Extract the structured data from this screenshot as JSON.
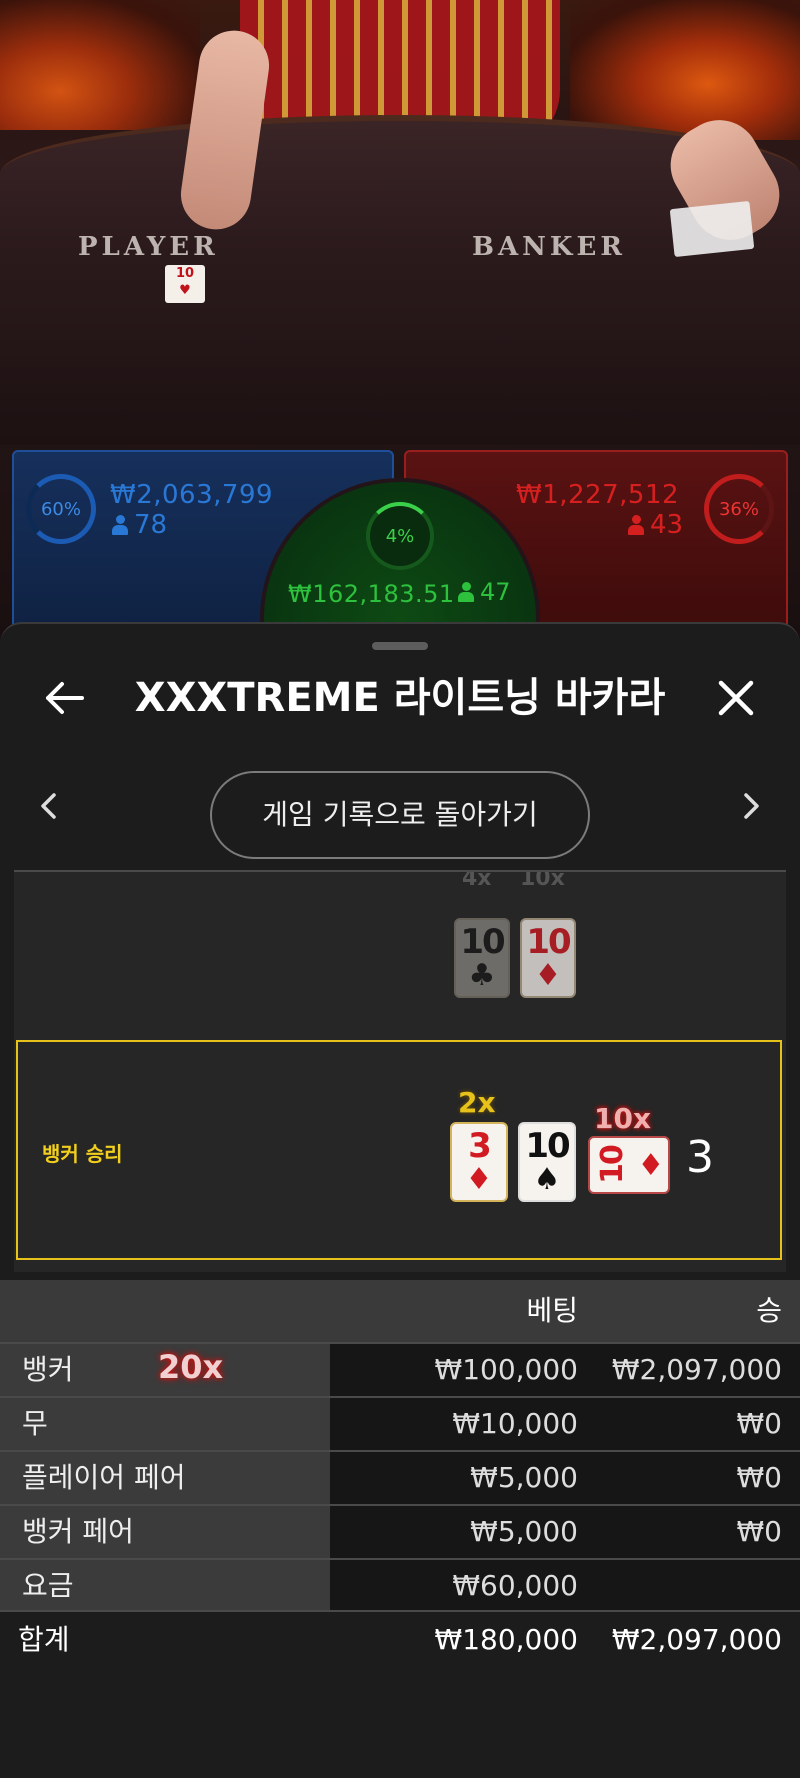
{
  "video": {
    "felt_player": "PLAYER",
    "felt_banker": "BANKER",
    "felt_card": "10",
    "player": {
      "percent": "60%",
      "amount": "₩2,063,799",
      "players": "78",
      "color": "#2a78d6"
    },
    "banker": {
      "percent": "36%",
      "amount": "₩1,227,512",
      "players": "43",
      "color": "#d62020"
    },
    "tie": {
      "percent": "4%",
      "amount": "₩162,183.51",
      "players": "47",
      "color": "#2ec13e"
    }
  },
  "sheet": {
    "title": "XXXTREME 라이트닝 바카라",
    "back_button": "게임 기록으로 돌아가기",
    "history": {
      "partial_row": {
        "multipliers": [
          "4x",
          "10x"
        ],
        "cards": [
          {
            "rank": "10",
            "suit": "♣"
          },
          {
            "rank": "10",
            "suit": "♦"
          }
        ]
      },
      "selected_row": {
        "label": "뱅커 승리",
        "multipliers": [
          "2x",
          "10x"
        ],
        "cards": [
          {
            "rank": "3",
            "suit": "♦"
          },
          {
            "rank": "10",
            "suit": "♠"
          },
          {
            "rank": "10",
            "suit": "♦"
          }
        ],
        "score": "3"
      }
    },
    "table": {
      "headers": {
        "bet": "베팅",
        "win": "승"
      },
      "rows": [
        {
          "label": "뱅커",
          "multiplier": "20x",
          "bet": "₩100,000",
          "win": "₩2,097,000"
        },
        {
          "label": "무",
          "bet": "₩10,000",
          "win": "₩0"
        },
        {
          "label": "플레이어 페어",
          "bet": "₩5,000",
          "win": "₩0"
        },
        {
          "label": "뱅커 페어",
          "bet": "₩5,000",
          "win": "₩0"
        },
        {
          "label": "요금",
          "bet": "₩60,000",
          "win": ""
        }
      ],
      "total": {
        "label": "합계",
        "bet": "₩180,000",
        "win": "₩2,097,000"
      }
    }
  },
  "colors": {
    "accent_yellow": "#e6c21a",
    "sheet_bg": "#1c1c1c"
  }
}
